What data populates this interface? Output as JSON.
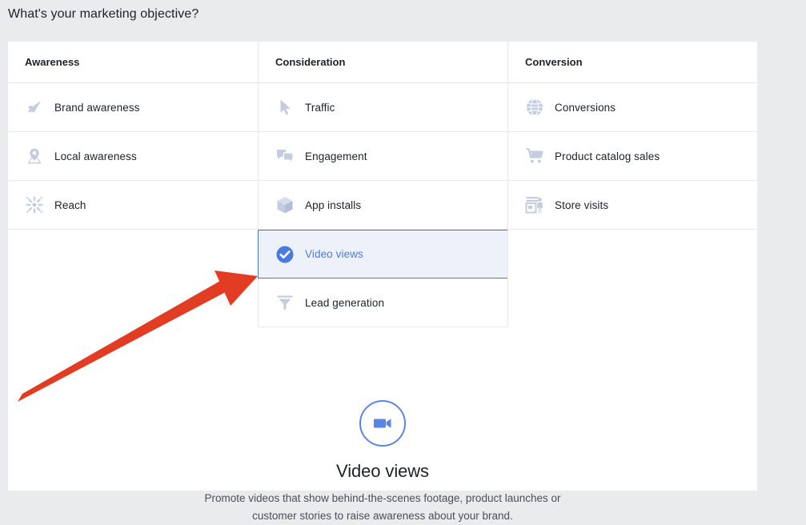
{
  "page": {
    "title": "What's your marketing objective?",
    "background_color": "#eaebed",
    "panel_color": "#ffffff"
  },
  "colors": {
    "accent_blue": "#4a7ae0",
    "selected_background": "#edf2fa",
    "selected_border": "#4a76c4",
    "icon_gray": "#c4cde0",
    "text_primary": "#1d2129",
    "text_secondary": "#4b4f56",
    "annotation_red": "#e23c22"
  },
  "objective_table": {
    "columns": [
      {
        "header": "Awareness",
        "items": [
          {
            "label": "Brand awareness",
            "icon": "megaphone-icon",
            "selected": false
          },
          {
            "label": "Local awareness",
            "icon": "map-pin-icon",
            "selected": false
          },
          {
            "label": "Reach",
            "icon": "reach-burst-icon",
            "selected": false
          }
        ]
      },
      {
        "header": "Consideration",
        "items": [
          {
            "label": "Traffic",
            "icon": "cursor-arrow-icon",
            "selected": false
          },
          {
            "label": "Engagement",
            "icon": "speech-bubbles-icon",
            "selected": false
          },
          {
            "label": "App installs",
            "icon": "cube-box-icon",
            "selected": false
          },
          {
            "label": "Video views",
            "icon": "check-circle-icon",
            "selected": true
          },
          {
            "label": "Lead generation",
            "icon": "funnel-icon",
            "selected": false
          }
        ]
      },
      {
        "header": "Conversion",
        "items": [
          {
            "label": "Conversions",
            "icon": "globe-icon",
            "selected": false
          },
          {
            "label": "Product catalog sales",
            "icon": "shopping-cart-icon",
            "selected": false
          },
          {
            "label": "Store visits",
            "icon": "storefront-icon",
            "selected": false
          }
        ]
      }
    ]
  },
  "objective_detail": {
    "icon": "video-camera-icon",
    "title": "Video views",
    "description": "Promote videos that show behind-the-scenes footage, product launches or customer stories to raise awareness about your brand."
  },
  "annotation": {
    "type": "arrow",
    "color": "#e23c22",
    "points_to": "Video views"
  }
}
